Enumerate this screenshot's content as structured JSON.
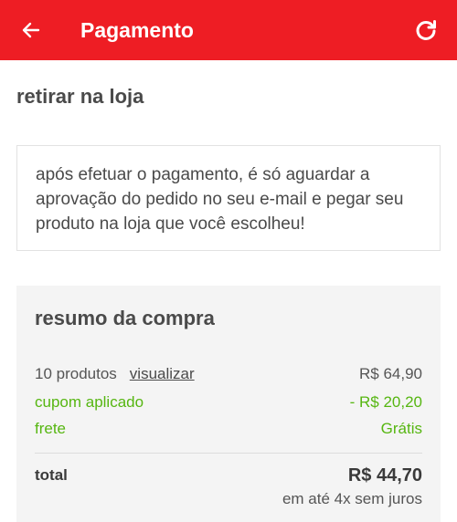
{
  "appbar": {
    "title": "Pagamento",
    "back_icon": "arrow-left-icon",
    "refresh_icon": "refresh-icon",
    "color": "#ee1d24"
  },
  "delivery": {
    "title": "retirar na loja",
    "info": "após efetuar o pagamento, é só aguardar a aprovação do pedido no seu e-mail e pegar seu produto na loja que você escolheu!"
  },
  "summary": {
    "title": "resumo da compra",
    "products_label": "10 produtos",
    "view_link": "visualizar",
    "products_value": "R$ 64,90",
    "coupon_label": "cupom aplicado",
    "coupon_value": "- R$ 20,20",
    "freight_label": "frete",
    "freight_value": "Grátis",
    "total_label": "total",
    "total_value": "R$ 44,70",
    "installments": "em até 4x sem juros",
    "highlight_color": "#56b611"
  }
}
